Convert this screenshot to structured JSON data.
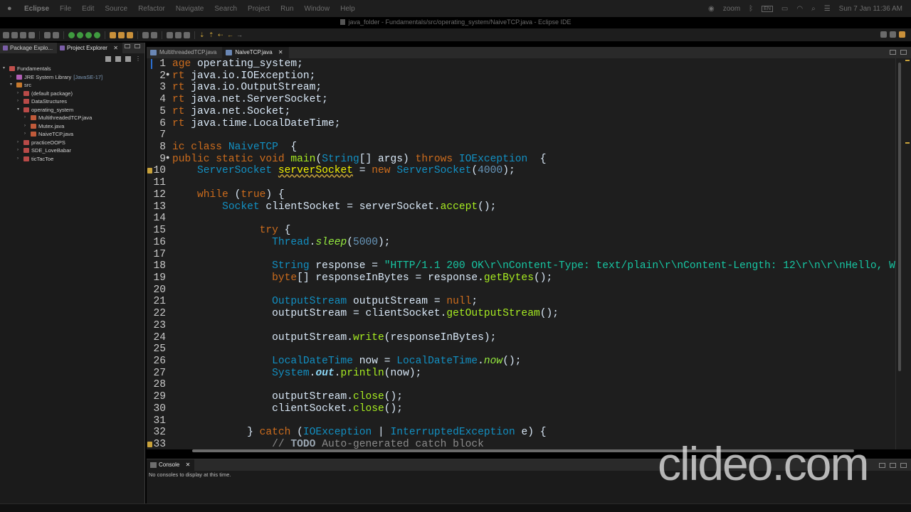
{
  "menubar": {
    "app_name": "Eclipse",
    "items": [
      "File",
      "Edit",
      "Source",
      "Refactor",
      "Navigate",
      "Search",
      "Project",
      "Run",
      "Window",
      "Help"
    ],
    "status_zoom": "zoom",
    "clock": "Sun 7 Jan  11:36 AM"
  },
  "window": {
    "title": "java_folder - Fundamentals/src/operating_system/NaiveTCP.java - Eclipse IDE"
  },
  "left_panel": {
    "tabs": [
      {
        "label": "Package Explo...",
        "active": false
      },
      {
        "label": "Project Explorer",
        "active": true
      }
    ],
    "tree": [
      {
        "label": "Fundamentals",
        "depth": 0,
        "expanded": true,
        "icon": "project-icon",
        "suffix": ""
      },
      {
        "label": "JRE System Library",
        "depth": 1,
        "expanded": false,
        "icon": "library-icon",
        "suffix": "[JavaSE-17]"
      },
      {
        "label": "src",
        "depth": 1,
        "expanded": true,
        "icon": "source-folder-icon",
        "suffix": ""
      },
      {
        "label": "(default package)",
        "depth": 2,
        "expanded": false,
        "icon": "package-icon",
        "suffix": ""
      },
      {
        "label": "DataStructures",
        "depth": 2,
        "expanded": false,
        "icon": "package-icon",
        "suffix": ""
      },
      {
        "label": "operating_system",
        "depth": 2,
        "expanded": true,
        "icon": "package-icon",
        "suffix": ""
      },
      {
        "label": "MultithreadedTCP.java",
        "depth": 3,
        "expanded": false,
        "icon": "java-file-icon",
        "suffix": ""
      },
      {
        "label": "Mutex.java",
        "depth": 3,
        "expanded": false,
        "icon": "java-file-icon",
        "suffix": ""
      },
      {
        "label": "NaiveTCP.java",
        "depth": 3,
        "expanded": false,
        "icon": "java-file-icon",
        "suffix": ""
      },
      {
        "label": "practiceOOPS",
        "depth": 2,
        "expanded": false,
        "icon": "package-icon",
        "suffix": ""
      },
      {
        "label": "SDE_LoveBabar",
        "depth": 2,
        "expanded": false,
        "icon": "package-icon",
        "suffix": ""
      },
      {
        "label": "ticTacToe",
        "depth": 2,
        "expanded": false,
        "icon": "package-icon",
        "suffix": ""
      }
    ]
  },
  "editor": {
    "tabs": [
      {
        "label": "MultithreadedTCP.java",
        "active": false
      },
      {
        "label": "NaiveTCP.java",
        "active": true
      }
    ],
    "lines": [
      {
        "n": "1",
        "fold": "",
        "marker": false,
        "html": "<span class=\"k\">age</span> operating_system;"
      },
      {
        "n": "2",
        "fold": "●",
        "marker": false,
        "html": "<span class=\"k\">rt</span> java.io.IOException;"
      },
      {
        "n": "3",
        "fold": "",
        "marker": false,
        "html": "<span class=\"k\">rt</span> java.io.OutputStream;"
      },
      {
        "n": "4",
        "fold": "",
        "marker": false,
        "html": "<span class=\"k\">rt</span> java.net.ServerSocket;"
      },
      {
        "n": "5",
        "fold": "",
        "marker": false,
        "html": "<span class=\"k\">rt</span> java.net.Socket;"
      },
      {
        "n": "6",
        "fold": "",
        "marker": false,
        "html": "<span class=\"k\">rt</span> java.time.LocalDateTime;"
      },
      {
        "n": "7",
        "fold": "",
        "marker": false,
        "html": ""
      },
      {
        "n": "8",
        "fold": "",
        "marker": false,
        "html": "<span class=\"k\">ic class</span> <span class=\"t\">NaiveTCP</span>  {"
      },
      {
        "n": "9",
        "fold": "●",
        "marker": false,
        "html": "<span class=\"k\">public static void</span> <span class=\"m\">main</span>(<span class=\"t\">String</span>[] args) <span class=\"k\">throws</span> <span class=\"t\">IOException</span>  {"
      },
      {
        "n": "10",
        "fold": "",
        "marker": true,
        "html": "    <span class=\"t\">ServerSocket</span> <span class=\"v\">serverSocket</span> = <span class=\"k\">new</span> <span class=\"t\">ServerSocket</span>(<span class=\"n\">4000</span>);"
      },
      {
        "n": "11",
        "fold": "",
        "marker": false,
        "html": ""
      },
      {
        "n": "12",
        "fold": "",
        "marker": false,
        "html": "    <span class=\"k\">while</span> (<span class=\"k\">true</span>) {"
      },
      {
        "n": "13",
        "fold": "",
        "marker": false,
        "html": "        <span class=\"t\">Socket</span> clientSocket = serverSocket.<span class=\"m\">accept</span>();"
      },
      {
        "n": "14",
        "fold": "",
        "marker": false,
        "html": ""
      },
      {
        "n": "15",
        "fold": "",
        "marker": false,
        "html": "              <span class=\"k\">try</span> {"
      },
      {
        "n": "16",
        "fold": "",
        "marker": false,
        "html": "                <span class=\"t\">Thread</span>.<span class=\"st\">sleep</span>(<span class=\"n\">5000</span>);"
      },
      {
        "n": "17",
        "fold": "",
        "marker": false,
        "html": ""
      },
      {
        "n": "18",
        "fold": "",
        "marker": false,
        "html": "                <span class=\"t\">String</span> response = <span class=\"s\">\"HTTP/1.1 200 OK\\r\\nContent-Type: text/plain\\r\\nContent-Length: 12\\r\\n\\r\\nHello, W</span>"
      },
      {
        "n": "19",
        "fold": "",
        "marker": false,
        "html": "                <span class=\"k\">byte</span>[] responseInBytes = response.<span class=\"m\">getBytes</span>();"
      },
      {
        "n": "20",
        "fold": "",
        "marker": false,
        "html": ""
      },
      {
        "n": "21",
        "fold": "",
        "marker": false,
        "html": "                <span class=\"t\">OutputStream</span> outputStream = <span class=\"k\">null</span>;"
      },
      {
        "n": "22",
        "fold": "",
        "marker": false,
        "html": "                outputStream = clientSocket.<span class=\"m\">getOutputStream</span>();"
      },
      {
        "n": "23",
        "fold": "",
        "marker": false,
        "html": ""
      },
      {
        "n": "24",
        "fold": "",
        "marker": false,
        "html": "                outputStream.<span class=\"m\">write</span>(responseInBytes);"
      },
      {
        "n": "25",
        "fold": "",
        "marker": false,
        "html": ""
      },
      {
        "n": "26",
        "fold": "",
        "marker": false,
        "html": "                <span class=\"t\">LocalDateTime</span> now = <span class=\"t\">LocalDateTime</span>.<span class=\"st\">now</span>();"
      },
      {
        "n": "27",
        "fold": "",
        "marker": false,
        "html": "                <span class=\"t\">System</span>.<span class=\"fl\">out</span>.<span class=\"m\">println</span>(now);"
      },
      {
        "n": "28",
        "fold": "",
        "marker": false,
        "html": ""
      },
      {
        "n": "29",
        "fold": "",
        "marker": false,
        "html": "                outputStream.<span class=\"m\">close</span>();"
      },
      {
        "n": "30",
        "fold": "",
        "marker": false,
        "html": "                clientSocket.<span class=\"m\">close</span>();"
      },
      {
        "n": "31",
        "fold": "",
        "marker": false,
        "html": ""
      },
      {
        "n": "32",
        "fold": "",
        "marker": false,
        "html": "            } <span class=\"k\">catch</span> (<span class=\"t\">IOException</span> | <span class=\"t\">InterruptedException</span> e) {"
      },
      {
        "n": "33",
        "fold": "",
        "marker": true,
        "html": "                <span class=\"cm\">// <span class=\"todo\">TODO</span> Auto-generated catch block</span>"
      }
    ]
  },
  "console": {
    "tab_label": "Console",
    "message": "No consoles to display at this time."
  },
  "watermark": {
    "text": "clideo.com"
  },
  "colors": {
    "keyword": "#cc6c1d",
    "type": "#1290c3",
    "string": "#17c6a3",
    "number": "#6897bb",
    "method": "#a7ec21",
    "background": "#1e1e1e"
  }
}
